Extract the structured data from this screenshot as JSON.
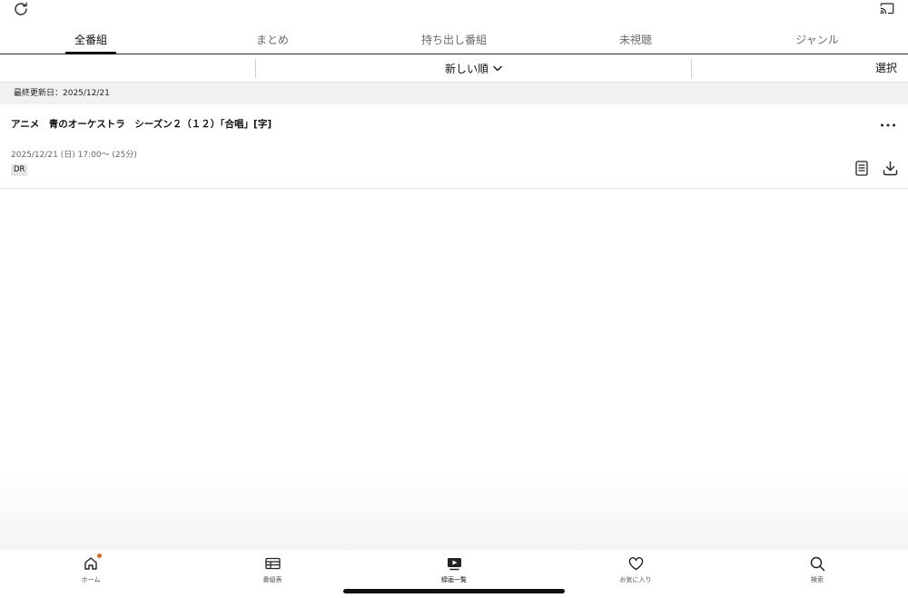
{
  "topbar": {
    "refresh_icon": "refresh-icon",
    "cast_icon": "cast-icon"
  },
  "tabs": [
    {
      "label": "全番組",
      "active": true
    },
    {
      "label": "まとめ",
      "active": false
    },
    {
      "label": "持ち出し番組",
      "active": false
    },
    {
      "label": "未視聴",
      "active": false
    },
    {
      "label": "ジャンル",
      "active": false
    }
  ],
  "sort": {
    "label": "新しい順",
    "select_label": "選択"
  },
  "updated": {
    "text": "最終更新日：2025/12/21"
  },
  "program": {
    "title": "アニメ　青のオーケストラ　シーズン２（１２）「合唱」[字]",
    "meta": "2025/12/21 (日) 17:00～ (25分)",
    "badge": "DR"
  },
  "bottom_nav": [
    {
      "label": "ホーム",
      "icon": "home-icon",
      "active": false,
      "notification": true
    },
    {
      "label": "番組表",
      "icon": "tv-guide-icon",
      "active": false,
      "notification": false
    },
    {
      "label": "録画一覧",
      "icon": "recordings-icon",
      "active": true,
      "notification": false
    },
    {
      "label": "お気に入り",
      "icon": "heart-icon",
      "active": false,
      "notification": false
    },
    {
      "label": "検索",
      "icon": "search-icon",
      "active": false,
      "notification": false
    }
  ],
  "colors": {
    "accent": "#111111",
    "notification_dot": "#e06a1b",
    "strip_background": "#f1f1f1"
  }
}
